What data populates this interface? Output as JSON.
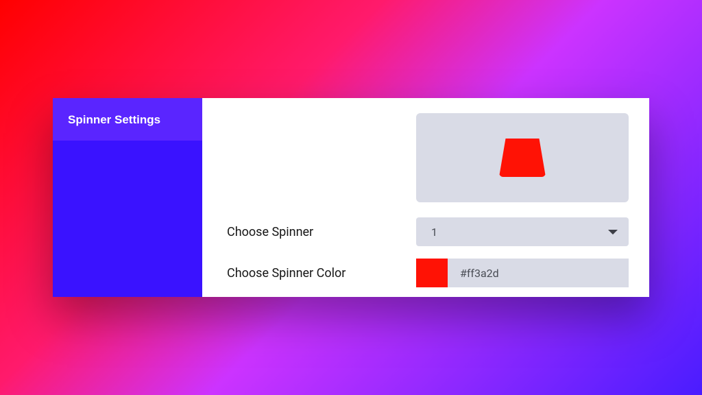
{
  "sidebar": {
    "tab_label": "Spinner Settings"
  },
  "form": {
    "choose_spinner_label": "Choose Spinner",
    "spinner_value": "1",
    "choose_color_label": "Choose Spinner Color",
    "color_hex": "#ff3a2d"
  },
  "colors": {
    "spinner": "#ff1205",
    "swatch": "#ff1205"
  }
}
